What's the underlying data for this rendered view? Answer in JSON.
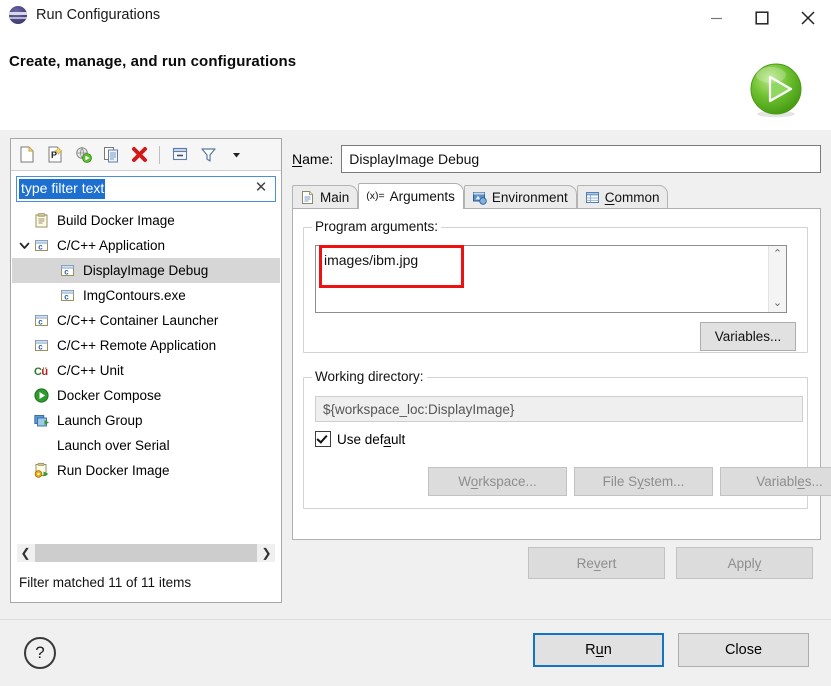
{
  "window": {
    "title": "Run Configurations",
    "app_icon": "eclipse-icon",
    "minimize": "minimize-icon",
    "maximize": "maximize-icon",
    "close": "close-icon"
  },
  "banner": {
    "title": "Create, manage, and run configurations",
    "badge_icon": "green-run-play-icon"
  },
  "toolbar": {
    "buttons": [
      {
        "name": "new-configuration",
        "icon": "new-document-icon"
      },
      {
        "name": "new-prototype",
        "icon": "new-prototype-p-icon"
      },
      {
        "name": "export",
        "icon": "export-globe-icon"
      },
      {
        "name": "duplicate",
        "icon": "duplicate-copy-icon"
      },
      {
        "name": "delete",
        "icon": "delete-red-x-icon"
      },
      {
        "name": "collapse-all",
        "icon": "collapse-all-icon"
      },
      {
        "name": "filter",
        "icon": "filter-funnel-icon"
      },
      {
        "name": "view-menu",
        "icon": "chevron-down-icon"
      }
    ]
  },
  "filter": {
    "value": "type filter text",
    "placeholder": "type filter text",
    "clear_icon": "clear-x-icon",
    "status": "Filter matched 11 of 11 items"
  },
  "tree": {
    "items": [
      {
        "label": "Build Docker Image",
        "icon": "docker-build-icon",
        "indent": 1,
        "twisty": "",
        "selected": false
      },
      {
        "label": "C/C++ Application",
        "icon": "c-window-icon",
        "indent": 0,
        "twisty": "expanded",
        "selected": false
      },
      {
        "label": "DisplayImage Debug",
        "icon": "c-window-icon",
        "indent": 2,
        "twisty": "",
        "selected": true
      },
      {
        "label": "ImgContours.exe",
        "icon": "c-window-icon",
        "indent": 2,
        "twisty": "",
        "selected": false
      },
      {
        "label": "C/C++ Container Launcher",
        "icon": "c-window-icon",
        "indent": 1,
        "twisty": "",
        "selected": false
      },
      {
        "label": "C/C++ Remote Application",
        "icon": "c-window-icon",
        "indent": 1,
        "twisty": "",
        "selected": false
      },
      {
        "label": "C/C++ Unit",
        "icon": "cunit-icon",
        "indent": 1,
        "twisty": "",
        "selected": false
      },
      {
        "label": "Docker Compose",
        "icon": "docker-compose-play-icon",
        "indent": 1,
        "twisty": "",
        "selected": false
      },
      {
        "label": "Launch Group",
        "icon": "launch-group-icon",
        "indent": 1,
        "twisty": "",
        "selected": false
      },
      {
        "label": "Launch over Serial",
        "icon": "",
        "indent": 1,
        "twisty": "",
        "selected": false
      },
      {
        "label": "Run Docker Image",
        "icon": "run-docker-image-icon",
        "indent": 1,
        "twisty": "",
        "selected": false
      }
    ],
    "scroll_left_icon": "chevron-left-icon",
    "scroll_right_icon": "chevron-right-icon"
  },
  "config": {
    "name_label": "Name:",
    "name_label_mnemonic": "N",
    "name_value": "DisplayImage Debug",
    "tabs": [
      {
        "label": "Main",
        "icon": "main-document-icon",
        "active": false
      },
      {
        "label": "Arguments",
        "icon": "arguments-xequals-icon",
        "active": true
      },
      {
        "label": "Environment",
        "icon": "environment-icon",
        "active": false
      },
      {
        "label": "Common",
        "icon": "common-table-icon",
        "active": false
      }
    ],
    "program_arguments": {
      "group_label": "Program arguments:",
      "value": "images/ibm.jpg",
      "scroll_up_icon": "chevron-up-icon",
      "scroll_down_icon": "chevron-down-icon",
      "variables_button": "Variables...",
      "highlight_color": "#ee1111"
    },
    "working_directory": {
      "group_label": "Working directory:",
      "value": "${workspace_loc:DisplayImage}",
      "use_default_label": "Use default",
      "use_default_checked": true,
      "buttons": [
        {
          "label": "Workspace...",
          "disabled": true
        },
        {
          "label": "File System...",
          "disabled": true
        },
        {
          "label": "Variables...",
          "disabled": true
        }
      ]
    },
    "revert_button": "Revert",
    "apply_button": "Apply"
  },
  "footer": {
    "help_icon": "help-question-icon",
    "run_button": "Run",
    "close_button": "Close"
  }
}
